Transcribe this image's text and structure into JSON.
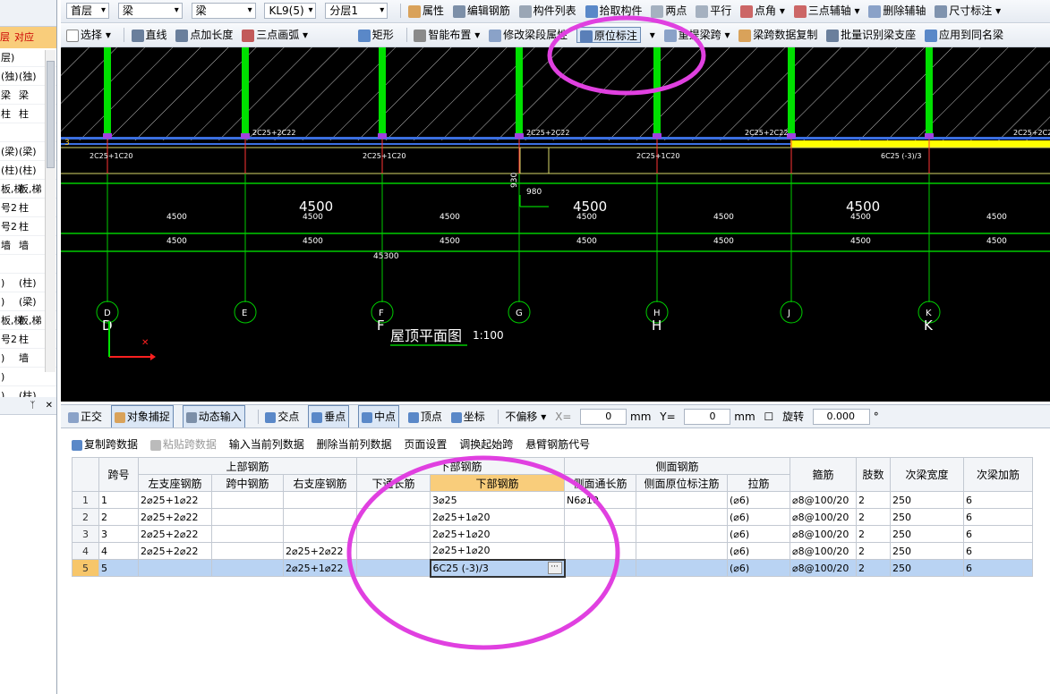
{
  "toolbar1": {
    "floor": "首层",
    "category": "梁",
    "type": "梁",
    "member": "KL9(5)",
    "layer": "分层1",
    "items": [
      "属性",
      "编辑钢筋",
      "构件列表",
      "拾取构件",
      "两点",
      "平行",
      "点角",
      "三点辅轴",
      "删除辅轴",
      "尺寸标注"
    ]
  },
  "toolbar2": {
    "items": [
      "选择",
      "直线",
      "点加长度",
      "三点画弧",
      "矩形",
      "智能布置",
      "修改梁段属性",
      "原位标注",
      "重提梁跨",
      "梁跨数据复制",
      "批量识别梁支座",
      "应用到同名梁"
    ]
  },
  "left_panel": {
    "header": [
      "层",
      "对应"
    ],
    "rows": [
      "层)",
      "(独)",
      "梁",
      "柱",
      "",
      "(梁)",
      "(柱)",
      "板,梯",
      "号2",
      "号2",
      "墙",
      "",
      ")",
      ")",
      "板,梯",
      "号2",
      ")",
      ")",
      ")"
    ],
    "rows_right": [
      "",
      "(独)",
      "梁",
      "柱",
      "",
      "(梁)",
      "(柱)",
      "板,梯",
      "柱",
      "柱",
      "墙",
      "",
      "(柱)",
      "(梁)",
      "板,梯",
      "柱",
      "墙",
      "",
      "(柱)"
    ]
  },
  "cad": {
    "top_rebar_labels": [
      "2C25+2C22",
      "2C25+2C22",
      "2C25+2C22",
      "2C25+2C22"
    ],
    "bottom_rebar_labels": [
      "2C25+1C20",
      "2C25+1C20",
      "2C25+1C20",
      "2C25+1C20",
      "6C25 (-3)/3"
    ],
    "dim_930": "930",
    "dim_980": "980",
    "span_big": [
      "4500",
      "4500",
      "4500"
    ],
    "span_small": [
      "4500",
      "4500",
      "4500",
      "4500",
      "4500",
      "4500",
      "4500"
    ],
    "total": "45300",
    "axes": [
      "D",
      "E",
      "F",
      "G",
      "H",
      "J",
      "K"
    ],
    "axes_large": [
      "D",
      "F",
      "H",
      "K"
    ],
    "plan_title": "屋顶平面图",
    "plan_scale": "1:100",
    "left_axis": "3"
  },
  "status_toolbar": {
    "items": [
      "正交",
      "对象捕捉",
      "动态输入",
      "交点",
      "垂点",
      "中点",
      "顶点",
      "坐标"
    ],
    "offset_mode": "不偏移",
    "x_label": "X=",
    "x_value": "0",
    "x_unit": "mm",
    "y_label": "Y=",
    "y_value": "0",
    "y_unit": "mm",
    "rotate_label": "旋转",
    "rotate_value": "0.000",
    "degree": "°"
  },
  "grid_toolbar": {
    "items": [
      "复制跨数据",
      "粘贴跨数据",
      "输入当前列数据",
      "删除当前列数据",
      "页面设置",
      "调换起始跨",
      "悬臂钢筋代号"
    ]
  },
  "table": {
    "group_headers": {
      "top": "上部钢筋",
      "bottom": "下部钢筋",
      "side": "侧面钢筋"
    },
    "columns": [
      "跨号",
      "左支座钢筋",
      "跨中钢筋",
      "右支座钢筋",
      "下通长筋",
      "下部钢筋",
      "侧面通长筋",
      "侧面原位标注筋",
      "拉筋",
      "箍筋",
      "肢数",
      "次梁宽度",
      "次梁加筋"
    ],
    "rows": [
      {
        "n": "1",
        "span": "1",
        "left": "2⌀25+1⌀22",
        "mid": "",
        "right": "",
        "bthru": "",
        "bottom": "3⌀25",
        "sthru": "N6⌀10",
        "sorig": "",
        "tie": "(⌀6)",
        "stirrup": "⌀8@100/20",
        "legs": "2",
        "sbw": "250",
        "sba": "6"
      },
      {
        "n": "2",
        "span": "2",
        "left": "2⌀25+2⌀22",
        "mid": "",
        "right": "",
        "bthru": "",
        "bottom": "2⌀25+1⌀20",
        "sthru": "",
        "sorig": "",
        "tie": "(⌀6)",
        "stirrup": "⌀8@100/20",
        "legs": "2",
        "sbw": "250",
        "sba": "6"
      },
      {
        "n": "3",
        "span": "3",
        "left": "2⌀25+2⌀22",
        "mid": "",
        "right": "",
        "bthru": "",
        "bottom": "2⌀25+1⌀20",
        "sthru": "",
        "sorig": "",
        "tie": "(⌀6)",
        "stirrup": "⌀8@100/20",
        "legs": "2",
        "sbw": "250",
        "sba": "6"
      },
      {
        "n": "4",
        "span": "4",
        "left": "2⌀25+2⌀22",
        "mid": "",
        "right": "2⌀25+2⌀22",
        "bthru": "",
        "bottom": "2⌀25+1⌀20",
        "sthru": "",
        "sorig": "",
        "tie": "(⌀6)",
        "stirrup": "⌀8@100/20",
        "legs": "2",
        "sbw": "250",
        "sba": "6"
      },
      {
        "n": "5",
        "span": "5",
        "left": "",
        "mid": "",
        "right": "2⌀25+1⌀22",
        "bthru": "",
        "bottom": "6C25 (-3)/3",
        "sthru": "",
        "sorig": "",
        "tie": "(⌀6)",
        "stirrup": "⌀8@100/20",
        "legs": "2",
        "sbw": "250",
        "sba": "6"
      }
    ]
  },
  "colors": {
    "annotation": "#e040e0",
    "cad_green": "#00e000",
    "cad_yellow": "#ffff00",
    "selected_row": "#b9d3f3"
  }
}
